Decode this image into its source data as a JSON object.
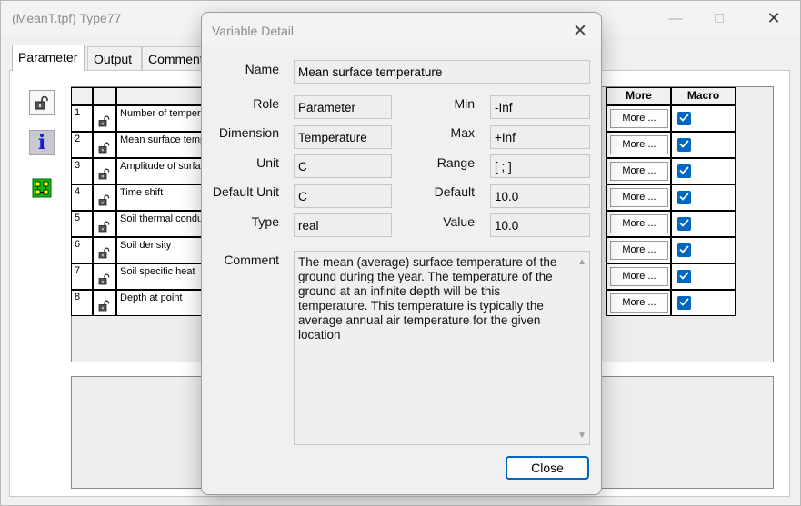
{
  "main_window": {
    "title": "(MeanT.tpf) Type77",
    "controls": {
      "minimize": "—",
      "maximize": "",
      "close": "✕"
    }
  },
  "tabs": [
    {
      "label": "Parameter",
      "active": true
    },
    {
      "label": "Output",
      "active": false
    },
    {
      "label": "Comment",
      "active": false
    }
  ],
  "sidebar": {
    "icons": [
      "lock-icon",
      "info-icon",
      "grid-icon"
    ]
  },
  "grid": {
    "columns": {
      "more": "More",
      "macro": "Macro"
    },
    "more_label": "More ...",
    "rows": [
      {
        "num": "1",
        "name": "Number of temperature terms",
        "macro": true
      },
      {
        "num": "2",
        "name": "Mean surface temperature",
        "macro": true
      },
      {
        "num": "3",
        "name": "Amplitude of surface temperature",
        "macro": true
      },
      {
        "num": "4",
        "name": "Time shift",
        "macro": true
      },
      {
        "num": "5",
        "name": "Soil thermal conductivity",
        "macro": true
      },
      {
        "num": "6",
        "name": "Soil density",
        "macro": true
      },
      {
        "num": "7",
        "name": "Soil specific heat",
        "macro": true
      },
      {
        "num": "8",
        "name": "Depth at point",
        "macro": true
      }
    ]
  },
  "dialog": {
    "title": "Variable Detail",
    "close_icon": "✕",
    "labels": {
      "name": "Name",
      "role": "Role",
      "dimension": "Dimension",
      "unit": "Unit",
      "default_unit": "Default Unit",
      "type": "Type",
      "min": "Min",
      "max": "Max",
      "range": "Range",
      "default": "Default",
      "value": "Value",
      "comment": "Comment"
    },
    "values": {
      "name": "Mean surface temperature",
      "role": "Parameter",
      "dimension": "Temperature",
      "unit": "C",
      "default_unit": "C",
      "type": "real",
      "min": "-Inf",
      "max": "+Inf",
      "range": "[ ; ]",
      "default": "10.0",
      "value": "10.0"
    },
    "comment": "The mean (average) surface temperature of the ground during the year.  The temperature of the ground at an infinite depth will be this temperature. This temperature is typically the average annual air temperature for the given location",
    "close_button": "Close"
  },
  "colors": {
    "accent": "#0067c0",
    "title_text": "#8a8a8a"
  }
}
